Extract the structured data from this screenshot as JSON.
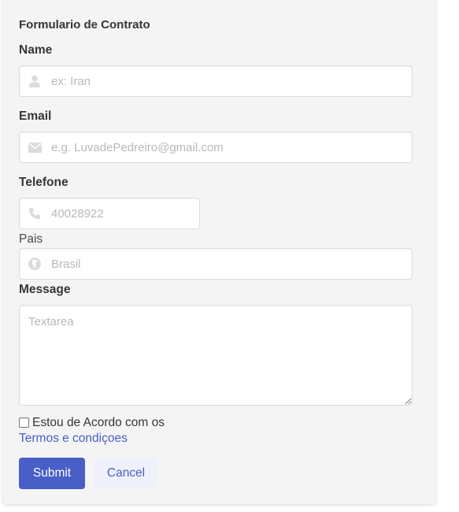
{
  "form": {
    "title": "Formulario de Contrato",
    "name_label": "Name",
    "name_placeholder": "ex: Iran",
    "email_label": "Email",
    "email_placeholder": "e.g. LuvadePedreiro@gmail.com",
    "phone_label": "Telefone",
    "phone_placeholder": "40028922",
    "country_label": "Pais",
    "country_placeholder": "Brasil",
    "message_label": "Message",
    "message_placeholder": "Textarea",
    "agree_text": "Estou de Acordo com os",
    "terms_link": "Termos e condiçoes",
    "submit_label": "Submit",
    "cancel_label": "Cancel"
  },
  "icons": {
    "name": "user-icon",
    "email": "envelope-icon",
    "phone": "phone-icon",
    "country": "globe-icon"
  },
  "colors": {
    "primary": "#485fc7",
    "primary_light": "#eff1fa",
    "card_background": "#f4f4f4",
    "icon": "#dbdbdb",
    "placeholder": "#b8b8b8"
  }
}
